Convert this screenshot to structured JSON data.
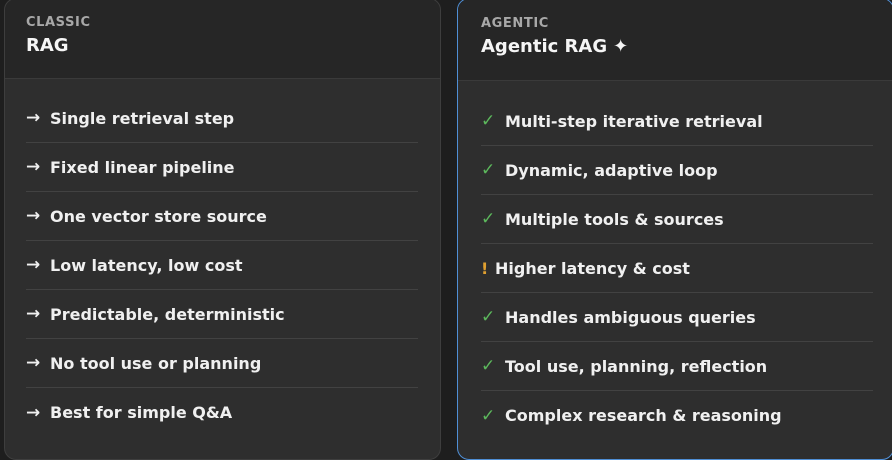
{
  "colors": {
    "background": "#1e1e1e",
    "card": "#2e2e2e",
    "accent_border": "#4f8fd6",
    "check": "#5cb85c",
    "warning": "#e0a030"
  },
  "classic": {
    "eyebrow": "CLASSIC",
    "title": "RAG",
    "items": [
      {
        "icon": "arrow-right-icon",
        "glyph": "→",
        "text": "Single retrieval step"
      },
      {
        "icon": "arrow-right-icon",
        "glyph": "→",
        "text": "Fixed linear pipeline"
      },
      {
        "icon": "arrow-right-icon",
        "glyph": "→",
        "text": "One vector store source"
      },
      {
        "icon": "arrow-right-icon",
        "glyph": "→",
        "text": "Low latency, low cost"
      },
      {
        "icon": "arrow-right-icon",
        "glyph": "→",
        "text": "Predictable, deterministic"
      },
      {
        "icon": "arrow-right-icon",
        "glyph": "→",
        "text": "No tool use or planning"
      },
      {
        "icon": "arrow-right-icon",
        "glyph": "→",
        "text": "Best for simple Q&A"
      }
    ]
  },
  "agentic": {
    "eyebrow": "AGENTIC",
    "title": "Agentic RAG",
    "title_icon": "✦",
    "items": [
      {
        "icon": "check-icon",
        "glyph": "✓",
        "text": "Multi-step iterative retrieval"
      },
      {
        "icon": "check-icon",
        "glyph": "✓",
        "text": "Dynamic, adaptive loop"
      },
      {
        "icon": "check-icon",
        "glyph": "✓",
        "text": "Multiple tools & sources"
      },
      {
        "icon": "warning-icon",
        "glyph": "!",
        "text": "Higher latency & cost"
      },
      {
        "icon": "check-icon",
        "glyph": "✓",
        "text": "Handles ambiguous queries"
      },
      {
        "icon": "check-icon",
        "glyph": "✓",
        "text": "Tool use, planning, reflection"
      },
      {
        "icon": "check-icon",
        "glyph": "✓",
        "text": "Complex research & reasoning"
      }
    ]
  }
}
